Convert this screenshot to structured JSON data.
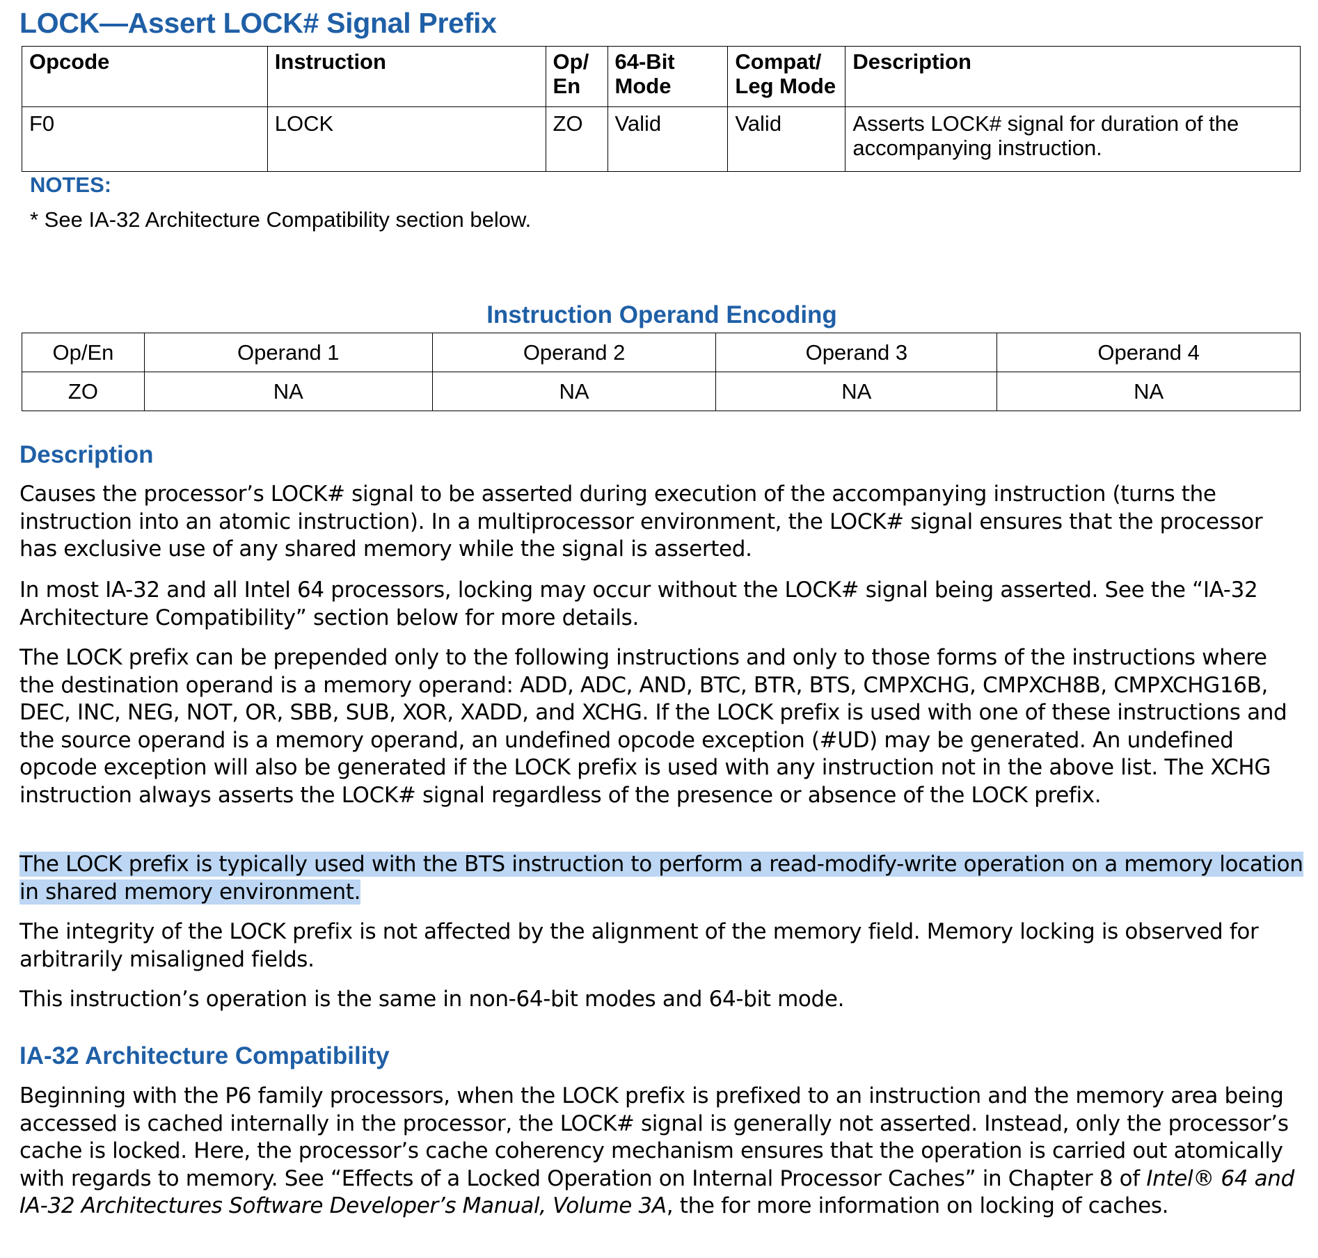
{
  "title": "LOCK—Assert LOCK# Signal Prefix",
  "opcode_table": {
    "headers": [
      "Opcode",
      "Instruction",
      "Op/\nEn",
      "64-Bit\nMode",
      "Compat/\nLeg Mode",
      "Description"
    ],
    "header_lines": {
      "op_en": [
        "Op/",
        "En"
      ],
      "mode64": [
        "64-Bit",
        "Mode"
      ],
      "compat": [
        "Compat/",
        "Leg Mode"
      ]
    },
    "row": {
      "opcode": "F0",
      "instruction": "LOCK",
      "op_en": "ZO",
      "mode64": "Valid",
      "compat": "Valid",
      "description": "Asserts LOCK# signal for duration of the accompanying instruction."
    }
  },
  "notes": {
    "heading": "NOTES:",
    "items": [
      "*  See IA-32 Architecture Compatibility section below."
    ]
  },
  "encoding": {
    "heading": "Instruction Operand Encoding",
    "headers": [
      "Op/En",
      "Operand 1",
      "Operand 2",
      "Operand 3",
      "Operand 4"
    ],
    "row": [
      "ZO",
      "NA",
      "NA",
      "NA",
      "NA"
    ]
  },
  "description": {
    "heading": "Description",
    "paragraphs": [
      "Causes the processor’s LOCK# signal to be asserted during execution of the accompanying instruction (turns the instruction into an atomic instruction). In a multiprocessor environment, the LOCK# signal ensures that the processor has exclusive use of any shared memory while the signal is asserted.",
      "In most IA-32 and all Intel 64 processors, locking may occur without the LOCK# signal being asserted. See the “IA-32 Architecture Compatibility” section below for more details.",
      "The LOCK prefix can be prepended only to the following instructions and only to those forms of the instructions where the destination operand is a memory operand: ADD, ADC, AND, BTC, BTR, BTS, CMPXCHG, CMPXCH8B, CMPXCHG16B, DEC, INC, NEG, NOT, OR, SBB, SUB, XOR, XADD, and XCHG. If the LOCK prefix is used with one of these instructions and the source operand is a memory operand, an undefined opcode exception (#UD) may be generated. An undefined opcode exception will also be generated if the LOCK prefix is used with any instruction not in the above list. The XCHG instruction always asserts the LOCK# signal regardless of the presence or absence of the LOCK prefix.",
      "The LOCK prefix is typically used with the BTS instruction to perform a read-modify-write operation on a memory location in shared memory environment.",
      "The integrity of the LOCK prefix is not affected by the alignment of the memory field. Memory locking is observed for arbitrarily misaligned fields.",
      "This instruction’s operation is the same in non-64-bit modes and 64-bit mode."
    ],
    "highlighted_paragraph_index": 3
  },
  "compat": {
    "heading": "IA-32 Architecture Compatibility",
    "text_before_italic": "Beginning with the P6 family processors, when the LOCK prefix is prefixed to an instruction and the memory area being accessed is cached internally in the processor, the LOCK# signal is generally not asserted. Instead, only the processor’s cache is locked. Here, the processor’s cache coherency mechanism ensures that the operation is carried out atomically with regards to memory. See “Effects of a Locked Operation on Internal Processor Caches” in Chapter 8 of ",
    "italic": "Intel® 64 and IA-32 Architectures Software Developer’s Manual, Volume 3A",
    "text_after_italic": ", the for more information on locking of caches."
  },
  "colors": {
    "heading_blue": "#1f5fa6",
    "highlight": "#bcd6f3"
  }
}
